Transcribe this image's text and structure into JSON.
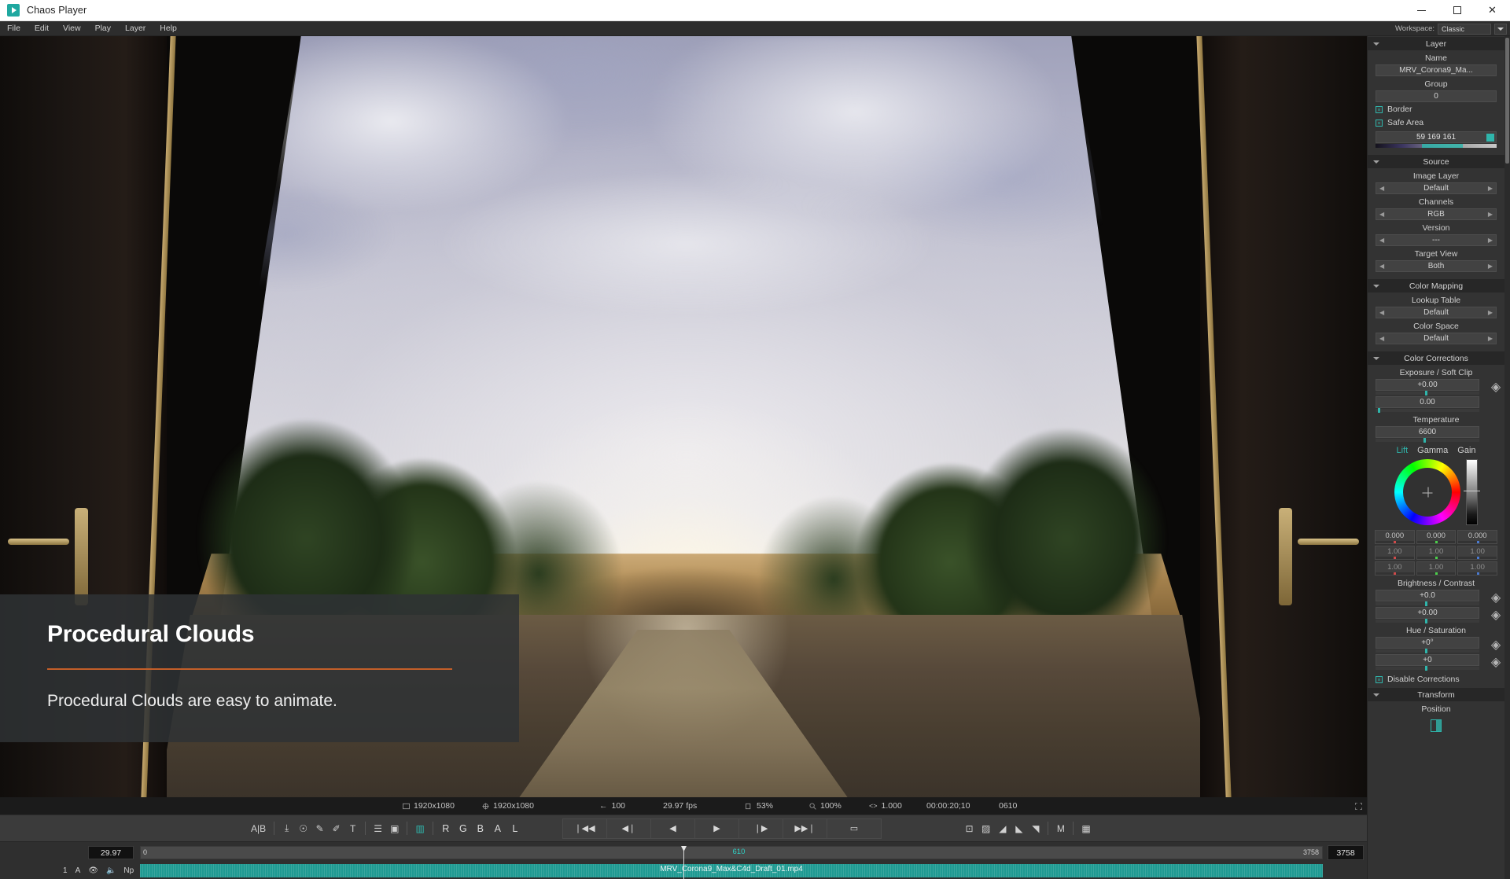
{
  "window": {
    "title": "Chaos Player",
    "app_icon": "play-icon",
    "minimize": "minimize-icon",
    "maximize": "maximize-icon",
    "close": "close-icon"
  },
  "menubar": {
    "items": [
      "File",
      "Edit",
      "View",
      "Play",
      "Layer",
      "Help"
    ],
    "workspace_label": "Workspace:",
    "workspace_value": "Classic"
  },
  "viewport": {
    "title_card": {
      "heading": "Procedural Clouds",
      "subtitle": "Procedural Clouds are easy to animate.",
      "rule_color": "#c45f29"
    }
  },
  "infobar": {
    "resolution_source": "1920x1080",
    "resolution_output": "1920x1080",
    "frame_offset": "100",
    "fps": "29.97 fps",
    "zoom_view": "53%",
    "zoom_image": "100%",
    "gamma": "1.000",
    "timecode": "00:00:20;10",
    "frame": "0610"
  },
  "toolbar": {
    "compare_label": "A|B",
    "tools": [
      {
        "name": "snapshot-icon",
        "glyph": "⤓"
      },
      {
        "name": "stamp-icon",
        "glyph": "☉"
      },
      {
        "name": "pencil-icon",
        "glyph": "✎"
      },
      {
        "name": "pencil-dashed-icon",
        "glyph": "✐"
      },
      {
        "name": "text-tool-icon",
        "glyph": "T"
      },
      {
        "name": "list-view-icon",
        "glyph": "☰"
      },
      {
        "name": "layout-view-icon",
        "glyph": "▣"
      },
      {
        "name": "split-view-icon",
        "glyph": "▥"
      }
    ],
    "channels": [
      "R",
      "G",
      "B",
      "A",
      "L"
    ],
    "transport": [
      {
        "name": "go-to-start-button",
        "glyph": "❘◀◀"
      },
      {
        "name": "step-back-button",
        "glyph": "◀❘"
      },
      {
        "name": "play-reverse-button",
        "glyph": "◀"
      },
      {
        "name": "play-button",
        "glyph": "▶"
      },
      {
        "name": "step-forward-button",
        "glyph": "❘▶"
      },
      {
        "name": "go-to-end-button",
        "glyph": "▶▶❘"
      },
      {
        "name": "loop-button",
        "glyph": "▭"
      }
    ],
    "right_tools": [
      {
        "name": "crop-icon",
        "glyph": "⊡"
      },
      {
        "name": "checker-icon",
        "glyph": "▨"
      },
      {
        "name": "compare-wipe-icon",
        "glyph": "◢"
      },
      {
        "name": "compare-stack-icon",
        "glyph": "◣"
      },
      {
        "name": "gradient-icon",
        "glyph": "◥"
      }
    ],
    "mute_label": "M",
    "grid_icon": "grid-icon"
  },
  "timeline": {
    "fps_value": "29.97",
    "start_label": "0",
    "playhead_label": "610",
    "end_label": "3758",
    "end_field": "3758",
    "track": {
      "number": "1",
      "audio_label": "A",
      "visibility_icon": "eye-icon",
      "audio_icon": "speaker-icon",
      "mode_label": "Np",
      "clip_name": "MRV_Corona9_Max&C4d_Draft_01.mp4",
      "clip_color": "#1f9a92"
    }
  },
  "panel": {
    "layer": {
      "header": "Layer",
      "name_label": "Name",
      "name_value": "MRV_Corona9_Ma...",
      "group_label": "Group",
      "group_value": "0",
      "border_label": "Border",
      "safe_area_label": "Safe Area",
      "safe_area_value": "59 169 161"
    },
    "source": {
      "header": "Source",
      "image_layer_label": "Image Layer",
      "image_layer_value": "Default",
      "channels_label": "Channels",
      "channels_value": "RGB",
      "version_label": "Version",
      "version_value": "---",
      "target_view_label": "Target View",
      "target_view_value": "Both"
    },
    "color_mapping": {
      "header": "Color Mapping",
      "lookup_table_label": "Lookup Table",
      "lookup_table_value": "Default",
      "color_space_label": "Color Space",
      "color_space_value": "Default"
    },
    "color_corrections": {
      "header": "Color Corrections",
      "exposure_label": "Exposure / Soft Clip",
      "exposure_value": "+0.00",
      "soft_clip_value": "0.00",
      "temperature_label": "Temperature",
      "temperature_value": "6600",
      "lgg_tabs": [
        "Lift",
        "Gamma",
        "Gain"
      ],
      "lgg_active": "Lift",
      "lift_rgb": [
        "0.000",
        "0.000",
        "0.000"
      ],
      "gamma_rgb": [
        "1.00",
        "1.00",
        "1.00"
      ],
      "gain_rgb": [
        "1.00",
        "1.00",
        "1.00"
      ],
      "brightness_contrast_label": "Brightness / Contrast",
      "brightness_value": "+0.0",
      "contrast_value": "+0.00",
      "hue_saturation_label": "Hue / Saturation",
      "hue_value": "+0°",
      "saturation_value": "+0",
      "disable_label": "Disable Corrections"
    },
    "transform": {
      "header": "Transform",
      "position_label": "Position"
    }
  }
}
